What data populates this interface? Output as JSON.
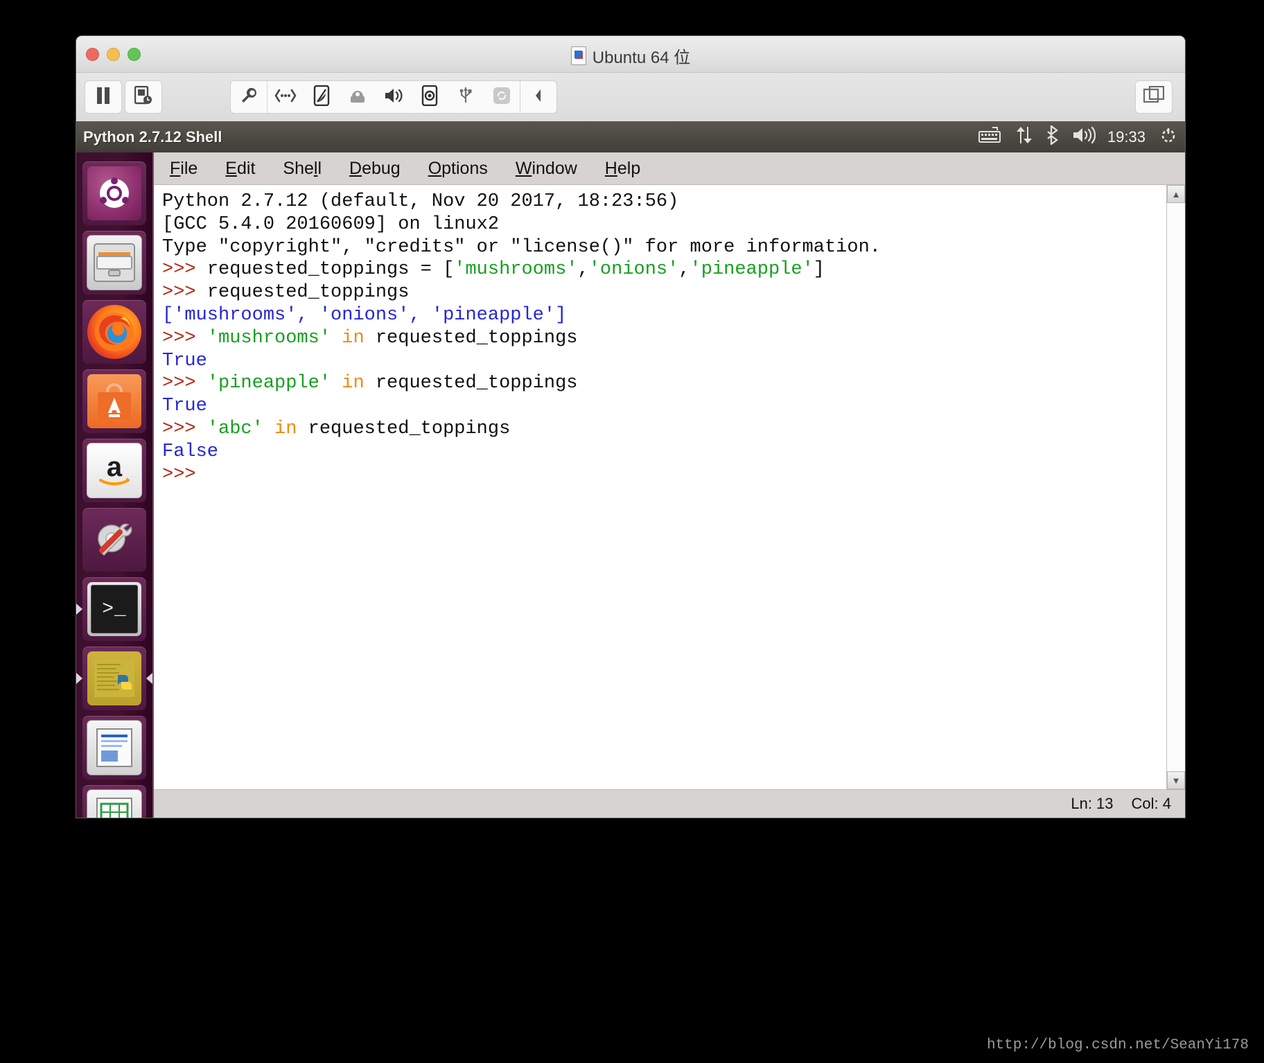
{
  "vmware": {
    "title": "Ubuntu 64 位",
    "title_icon": "vm-document-icon",
    "window_controls": [
      {
        "name": "close-button",
        "color": "#ed6a5e"
      },
      {
        "name": "minimize-button",
        "color": "#f5bf4f"
      },
      {
        "name": "zoom-button",
        "color": "#62c554"
      }
    ],
    "toolbar_left": [
      {
        "name": "pause-button",
        "icon": "pause-icon"
      },
      {
        "name": "snapshot-button",
        "icon": "snapshot-clock-icon"
      }
    ],
    "toolbar_devices": [
      {
        "name": "settings-button",
        "icon": "wrench-icon"
      },
      {
        "name": "network-button",
        "icon": "network-icon"
      },
      {
        "name": "harddisk-button",
        "icon": "harddisk-icon"
      },
      {
        "name": "printer-button",
        "icon": "printer-icon"
      },
      {
        "name": "sound-button",
        "icon": "speaker-icon"
      },
      {
        "name": "camera-button",
        "icon": "camera-icon"
      },
      {
        "name": "usb-button",
        "icon": "usb-icon"
      },
      {
        "name": "sync-button",
        "icon": "sync-icon"
      }
    ],
    "toolbar_collapse": {
      "name": "collapse-toolbar-button",
      "icon": "chevron-left-icon"
    },
    "toolbar_right": {
      "name": "unity-view-button",
      "icon": "windows-overlap-icon"
    }
  },
  "ubuntu_panel": {
    "window_title": "Python 2.7.12 Shell",
    "indicators": [
      {
        "name": "keyboard-indicator",
        "icon": "keyboard-icon"
      },
      {
        "name": "network-indicator",
        "icon": "updown-arrows-icon"
      },
      {
        "name": "bluetooth-indicator",
        "icon": "bluetooth-icon"
      },
      {
        "name": "volume-indicator",
        "icon": "speaker-waves-icon"
      }
    ],
    "clock": "19:33",
    "session_icon": "power-gear-icon"
  },
  "launcher": {
    "items": [
      {
        "name": "launcher-item-dash",
        "icon": "ubuntu-logo-icon",
        "running": false
      },
      {
        "name": "launcher-item-files",
        "icon": "file-cabinet-icon",
        "running": false
      },
      {
        "name": "launcher-item-firefox",
        "icon": "firefox-icon",
        "running": false
      },
      {
        "name": "launcher-item-software",
        "icon": "ubuntu-software-bag-icon",
        "running": false
      },
      {
        "name": "launcher-item-amazon",
        "icon": "amazon-icon",
        "running": false
      },
      {
        "name": "launcher-item-settings",
        "icon": "gear-wrench-icon",
        "running": false
      },
      {
        "name": "launcher-item-terminal",
        "icon": "terminal-icon",
        "running": true
      },
      {
        "name": "launcher-item-idle",
        "icon": "python-idle-icon",
        "running": true
      },
      {
        "name": "launcher-item-writer",
        "icon": "document-writer-icon",
        "running": false
      },
      {
        "name": "launcher-item-calc",
        "icon": "spreadsheet-calc-icon",
        "running": false
      },
      {
        "name": "launcher-item-impress",
        "icon": "presentation-impress-icon",
        "running": false
      }
    ],
    "terminal_glyph": ">_",
    "amazon_glyph": "a"
  },
  "idle": {
    "menus": [
      {
        "name": "menu-file",
        "pre": "",
        "key": "F",
        "post": "ile"
      },
      {
        "name": "menu-edit",
        "pre": "",
        "key": "E",
        "post": "dit"
      },
      {
        "name": "menu-shell",
        "pre": "She",
        "key": "l",
        "post": "l"
      },
      {
        "name": "menu-debug",
        "pre": "",
        "key": "D",
        "post": "ebug"
      },
      {
        "name": "menu-options",
        "pre": "",
        "key": "O",
        "post": "ptions"
      },
      {
        "name": "menu-window",
        "pre": "",
        "key": "W",
        "post": "indow"
      },
      {
        "name": "menu-help",
        "pre": "",
        "key": "H",
        "post": "elp"
      }
    ],
    "console_lines": [
      [
        {
          "t": "plain",
          "s": "Python 2.7.12 (default, Nov 20 2017, 18:23:56) "
        }
      ],
      [
        {
          "t": "plain",
          "s": "[GCC 5.4.0 20160609] on linux2"
        }
      ],
      [
        {
          "t": "plain",
          "s": "Type \"copyright\", \"credits\" or \"license()\" for more information."
        }
      ],
      [
        {
          "t": "prompt",
          "s": ">>> "
        },
        {
          "t": "plain",
          "s": "requested_toppings = ["
        },
        {
          "t": "str",
          "s": "'mushrooms'"
        },
        {
          "t": "plain",
          "s": ","
        },
        {
          "t": "str",
          "s": "'onions'"
        },
        {
          "t": "plain",
          "s": ","
        },
        {
          "t": "str",
          "s": "'pineapple'"
        },
        {
          "t": "plain",
          "s": "]"
        }
      ],
      [
        {
          "t": "prompt",
          "s": ">>> "
        },
        {
          "t": "plain",
          "s": "requested_toppings"
        }
      ],
      [
        {
          "t": "out",
          "s": "['mushrooms', 'onions', 'pineapple']"
        }
      ],
      [
        {
          "t": "prompt",
          "s": ">>> "
        },
        {
          "t": "str",
          "s": "'mushrooms'"
        },
        {
          "t": "plain",
          "s": " "
        },
        {
          "t": "kw",
          "s": "in"
        },
        {
          "t": "plain",
          "s": " requested_toppings"
        }
      ],
      [
        {
          "t": "out",
          "s": "True"
        }
      ],
      [
        {
          "t": "prompt",
          "s": ">>> "
        },
        {
          "t": "str",
          "s": "'pineapple'"
        },
        {
          "t": "plain",
          "s": " "
        },
        {
          "t": "kw",
          "s": "in"
        },
        {
          "t": "plain",
          "s": " requested_toppings"
        }
      ],
      [
        {
          "t": "out",
          "s": "True"
        }
      ],
      [
        {
          "t": "prompt",
          "s": ">>> "
        },
        {
          "t": "str",
          "s": "'abc'"
        },
        {
          "t": "plain",
          "s": " "
        },
        {
          "t": "kw",
          "s": "in"
        },
        {
          "t": "plain",
          "s": " requested_toppings"
        }
      ],
      [
        {
          "t": "out",
          "s": "False"
        }
      ],
      [
        {
          "t": "prompt",
          "s": ">>> "
        }
      ]
    ],
    "scrollbar": {
      "up_glyph": "▲",
      "down_glyph": "▼"
    },
    "status": {
      "line": "Ln: 13",
      "col": "Col: 4"
    }
  },
  "watermark": "http://blog.csdn.net/SeanYi178",
  "colors": {
    "prompt": "#b02c17",
    "string": "#18a021",
    "keyword": "#ef8c10",
    "output": "#2626d6",
    "ubuntu_aubergine": "#2c001e",
    "panel": "#413d38"
  }
}
